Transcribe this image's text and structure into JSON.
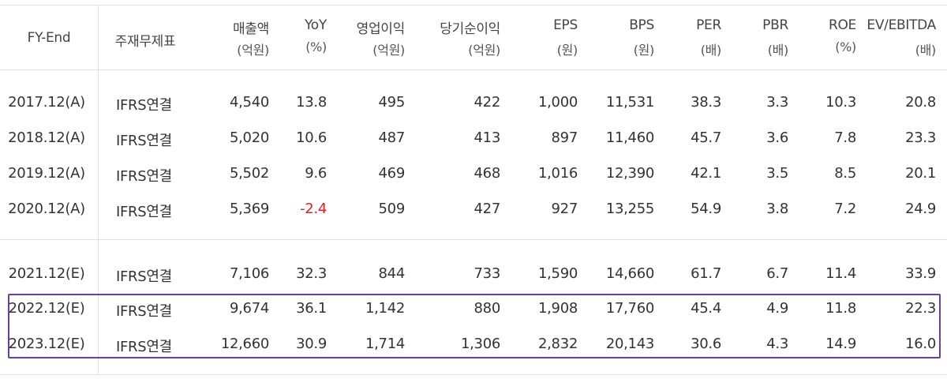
{
  "header": {
    "fy_end": "FY-End",
    "fin_statement": "주재무제표",
    "columns": [
      {
        "label": "매출액",
        "unit": "(억원)"
      },
      {
        "label": "YoY",
        "unit": "(%)"
      },
      {
        "label": "영업이익",
        "unit": "(억원)"
      },
      {
        "label": "당기순이익",
        "unit": "(억원)"
      },
      {
        "label": "EPS",
        "unit": "(원)"
      },
      {
        "label": "BPS",
        "unit": "(원)"
      },
      {
        "label": "PER",
        "unit": "(배)"
      },
      {
        "label": "PBR",
        "unit": "(배)"
      },
      {
        "label": "ROE",
        "unit": "(%)"
      },
      {
        "label": "EV/EBITDA",
        "unit": "(배)"
      }
    ]
  },
  "rows": [
    {
      "fy": "2017.12(A)",
      "fs": "IFRS연결",
      "values": [
        "4,540",
        "13.8",
        "495",
        "422",
        "1,000",
        "11,531",
        "38.3",
        "3.3",
        "10.3",
        "20.8"
      ]
    },
    {
      "fy": "2018.12(A)",
      "fs": "IFRS연결",
      "values": [
        "5,020",
        "10.6",
        "487",
        "413",
        "897",
        "11,460",
        "45.7",
        "3.6",
        "7.8",
        "23.3"
      ]
    },
    {
      "fy": "2019.12(A)",
      "fs": "IFRS연결",
      "values": [
        "5,502",
        "9.6",
        "469",
        "468",
        "1,016",
        "12,390",
        "42.1",
        "3.5",
        "8.5",
        "20.1"
      ]
    },
    {
      "fy": "2020.12(A)",
      "fs": "IFRS연결",
      "values": [
        "5,369",
        "-2.4",
        "509",
        "427",
        "927",
        "13,255",
        "54.9",
        "3.8",
        "7.2",
        "24.9"
      ]
    },
    {
      "fy": "2021.12(E)",
      "fs": "IFRS연결",
      "values": [
        "7,106",
        "32.3",
        "844",
        "733",
        "1,590",
        "14,660",
        "61.7",
        "6.7",
        "11.4",
        "33.9"
      ]
    },
    {
      "fy": "2022.12(E)",
      "fs": "IFRS연결",
      "values": [
        "9,674",
        "36.1",
        "1,142",
        "880",
        "1,908",
        "17,760",
        "45.4",
        "4.9",
        "11.8",
        "22.3"
      ]
    },
    {
      "fy": "2023.12(E)",
      "fs": "IFRS연결",
      "values": [
        "12,660",
        "30.9",
        "1,714",
        "1,306",
        "2,832",
        "20,143",
        "30.6",
        "4.3",
        "14.9",
        "16.0"
      ]
    }
  ],
  "colors": {
    "negative": "#e02020",
    "highlight_border": "#6a3fa0",
    "rule": "#e2e2e2"
  }
}
